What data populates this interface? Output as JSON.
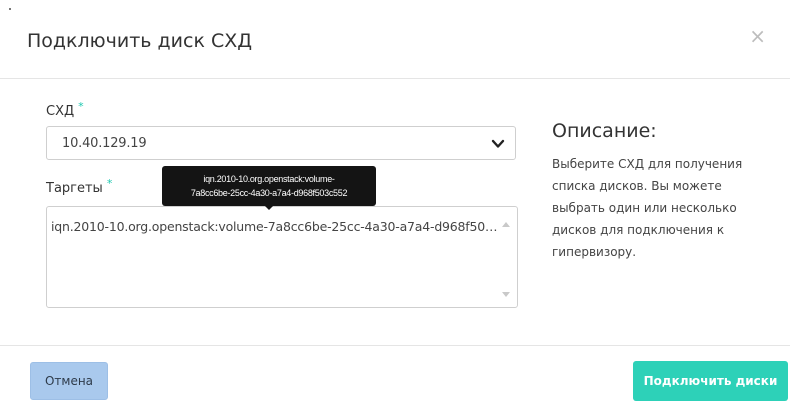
{
  "dialog": {
    "title": "Подключить диск СХД",
    "close_glyph": "×"
  },
  "form": {
    "storage": {
      "label": "СХД",
      "required_mark": "*",
      "selected_value": "10.40.129.19"
    },
    "targets": {
      "label": "Таргеты",
      "required_mark": "*",
      "options": [
        "iqn.2010-10.org.openstack:volume-7a8cc6be-25cc-4a30-a7a4-d968f503c552"
      ],
      "tooltip_line1": "iqn.2010-10.org.openstack:volume-",
      "tooltip_line2": "7a8cc6be-25cc-4a30-a7a4-d968f503c552"
    }
  },
  "description": {
    "heading": "Описание:",
    "text": "Выберите СХД для получения списка дисков. Вы можете выбрать один или несколько дисков для подключения к гипервизору."
  },
  "footer": {
    "cancel_label": "Отмена",
    "submit_label": "Подключить диски"
  },
  "colors": {
    "accent": "#2dd1b8",
    "required_mark": "#1fc8b0",
    "cancel_bg": "#a9c9ed",
    "tooltip_bg": "#141414"
  }
}
